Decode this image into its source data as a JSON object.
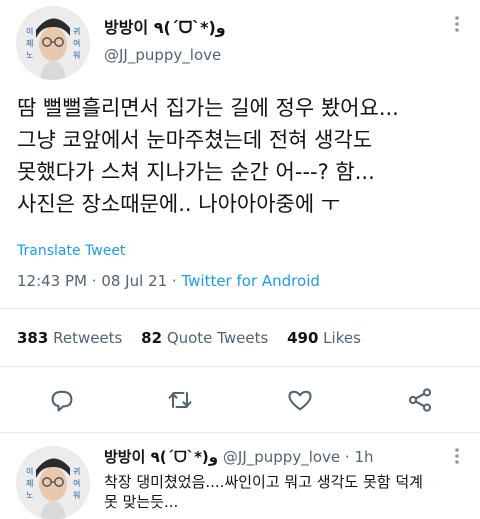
{
  "tweet": {
    "author_name": "방방이 ٩(ˊᗜˋ*)و",
    "author_handle": "@JJ_puppy_love",
    "avatar_text": [
      "이",
      "제",
      "노",
      "귀",
      "여",
      "워"
    ],
    "body_lines": [
      "땀 뻘뻘흘리면서 집가는 길에 정우 봤어요...",
      "그냥 코앞에서 눈마주쳤는데 전혀 생각도",
      "못했다가  스쳐 지나가는 순간 어---? 함...",
      "사진은 장소때문에.. 나아아아중에 ㅜ"
    ],
    "translate_label": "Translate Tweet",
    "time": "12:43 PM",
    "date": "08 Jul 21",
    "source": "Twitter for Android",
    "retweets_count": "383",
    "retweets_label": "Retweets",
    "quotes_count": "82",
    "quotes_label": "Quote Tweets",
    "likes_count": "490",
    "likes_label": "Likes"
  },
  "reply": {
    "author_name": "방방이 ٩(ˊᗜˋ*)و",
    "author_handle": "@JJ_puppy_love",
    "age": "1h",
    "text_lines": [
      "착장 댕미쳤었음....싸인이고 뭐고 생각도 못함 덕계",
      "못 맞는듯..."
    ]
  },
  "colors": {
    "accent": "#1d9bf0",
    "secondary_text": "#536471",
    "primary_text": "#0f1419",
    "divider": "#e6ecf0"
  },
  "icons": [
    "more-vertical-icon",
    "reply-icon",
    "retweet-icon",
    "like-icon",
    "share-icon"
  ]
}
